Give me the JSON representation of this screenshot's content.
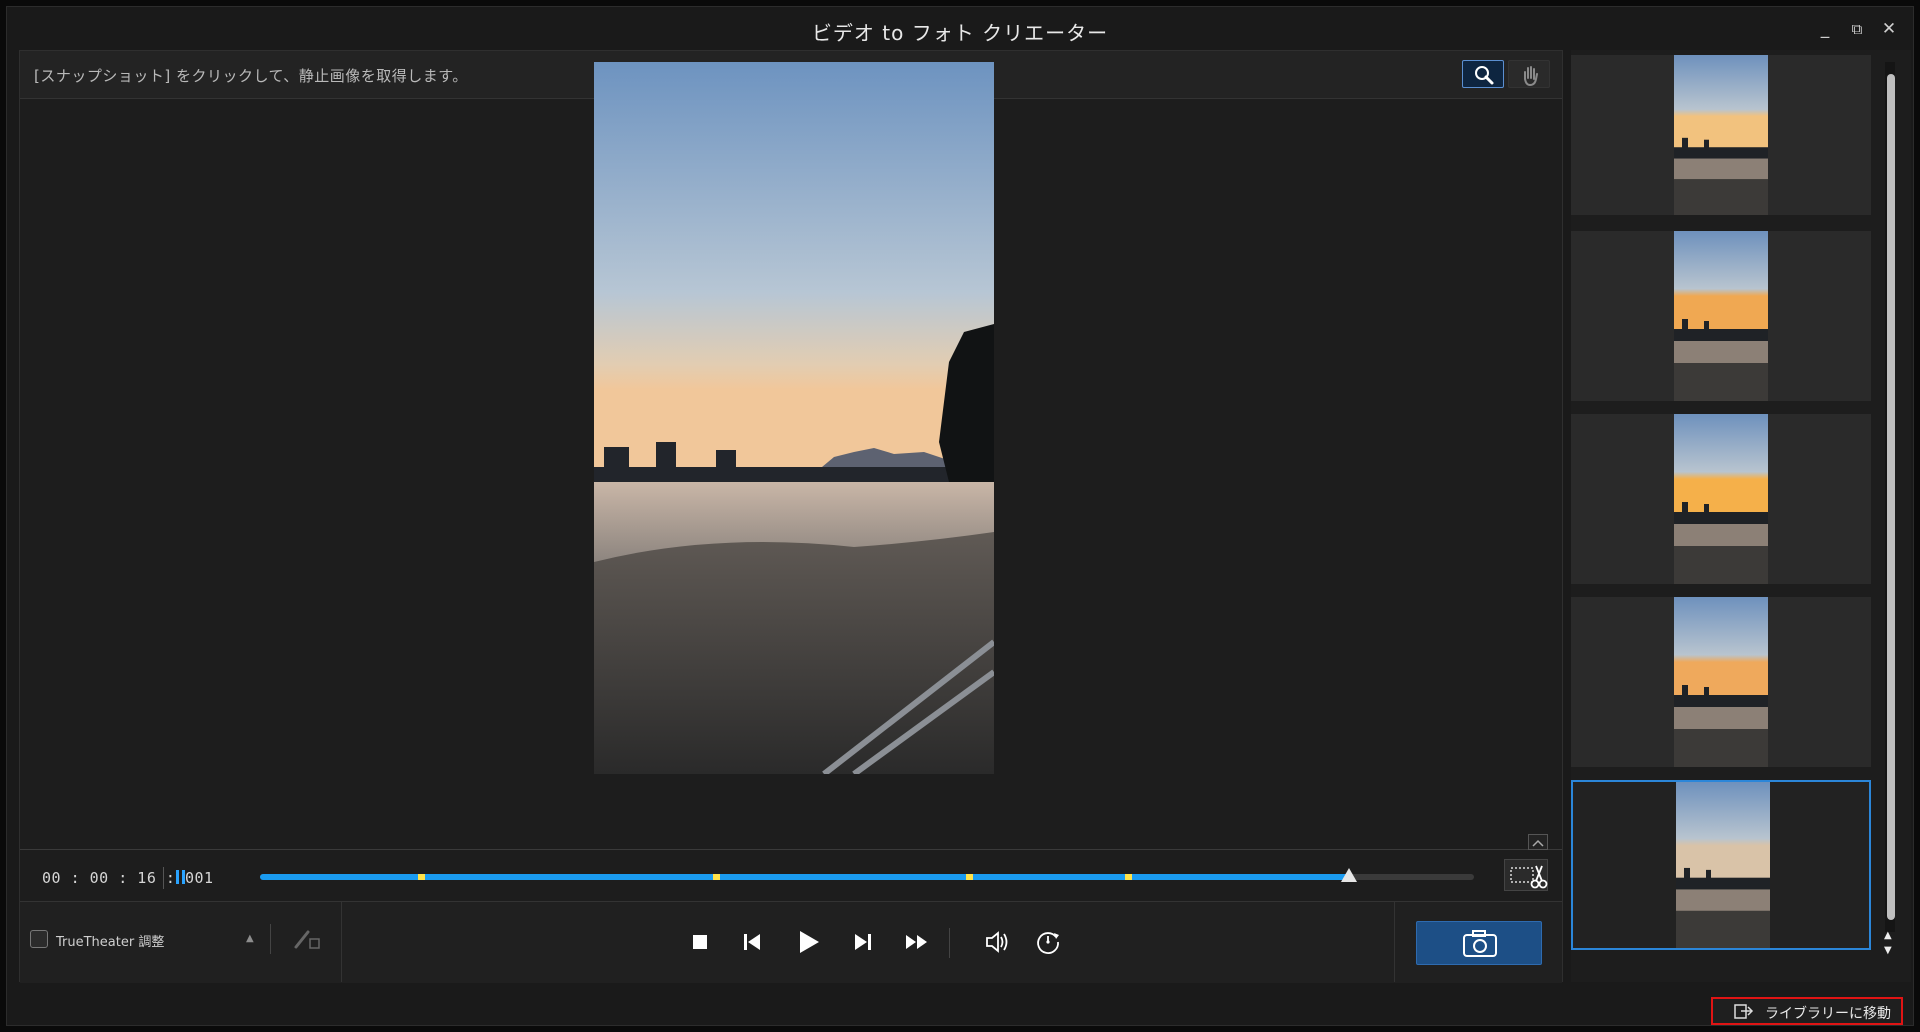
{
  "window": {
    "title": "ビデオ to フォト クリエーター",
    "minimize_label": "_",
    "restore_label": "⧉",
    "close_label": "✕"
  },
  "hint": {
    "text": "[スナップショット] をクリックして、静止画像を取得します。"
  },
  "tools": {
    "zoom_icon": "magnifier-icon",
    "hand_icon": "hand-icon"
  },
  "timeline": {
    "timecode": "00 : 00 : 16 : 001",
    "progress": 0.897,
    "markers": [
      0.133,
      0.376,
      0.584,
      0.715
    ]
  },
  "bottom": {
    "truetheater_label": "TrueTheater 調整"
  },
  "thumbnails": [
    {
      "id": 1
    },
    {
      "id": 2
    },
    {
      "id": 3
    },
    {
      "id": 4
    },
    {
      "id": 5,
      "selected": true
    }
  ],
  "library": {
    "label": "ライブラリーに移動"
  },
  "colors": {
    "accent": "#1a9bf0",
    "marker": "#ffe24a",
    "snapshot_button": "#1d4f86",
    "highlight_border": "#e01414"
  }
}
